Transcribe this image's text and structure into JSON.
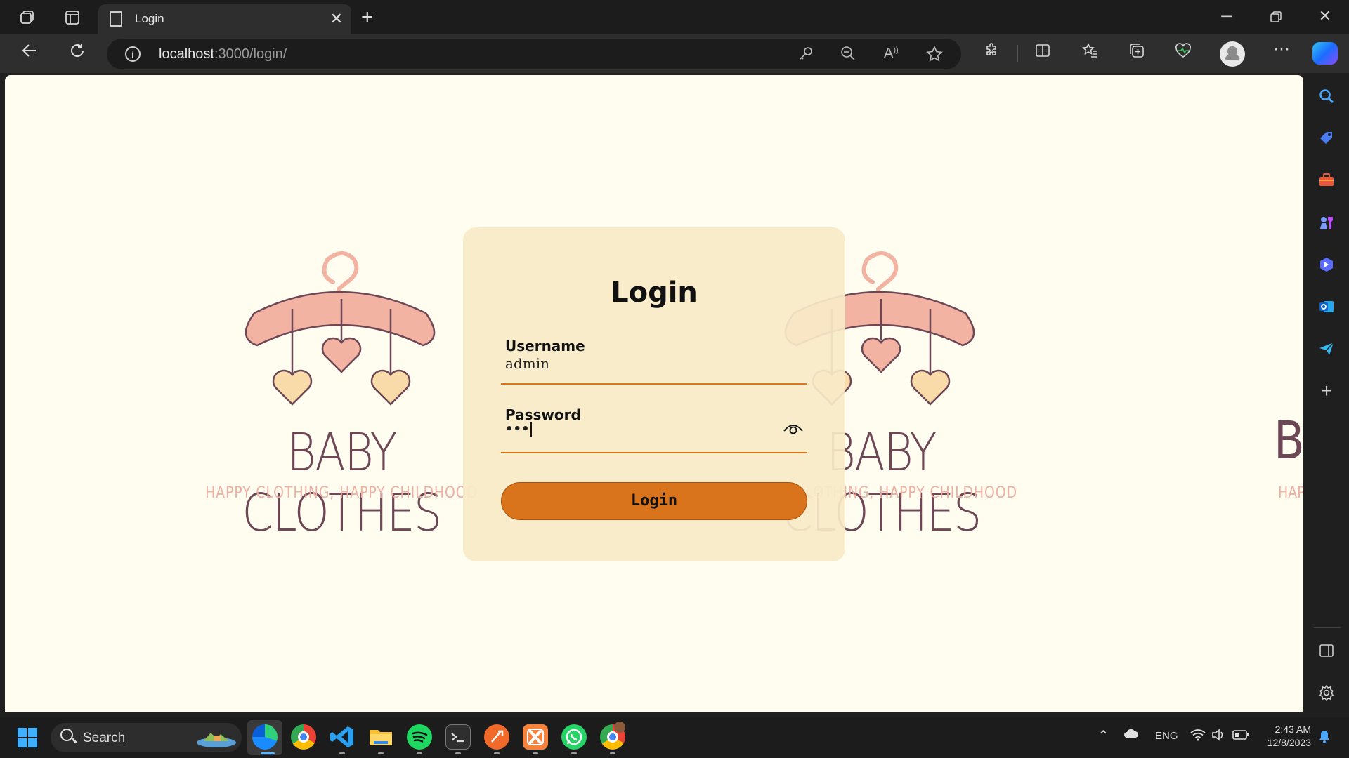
{
  "browser": {
    "tab_title": "Login",
    "new_tab_glyph": "+",
    "tab_close_glyph": "✕",
    "url_host": "localhost",
    "url_path": ":3000/login/"
  },
  "page": {
    "brand_name": "BABY CLOTHES",
    "brand_tagline": "HAPPY CLOTHING, HAPPY CHILDHOOD",
    "brand_partial_name": "B",
    "brand_partial_tag": "HAP",
    "form": {
      "title": "Login",
      "username_label": "Username",
      "username_value": "admin",
      "password_label": "Password",
      "password_value": "•••",
      "submit_label": "Login"
    }
  },
  "taskbar": {
    "search_label": "Search",
    "language": "ENG",
    "time": "2:43 AM",
    "date": "12/8/2023"
  },
  "colors": {
    "page_bg": "#fffdf0",
    "card_bg": "#f8eac8",
    "accent": "#d9731c",
    "brand_text": "#6e4756",
    "tagline": "#efafa3",
    "hanger": "#f3b3a3",
    "heart_pink": "#f3b3a3",
    "heart_yellow": "#f8dba8"
  }
}
